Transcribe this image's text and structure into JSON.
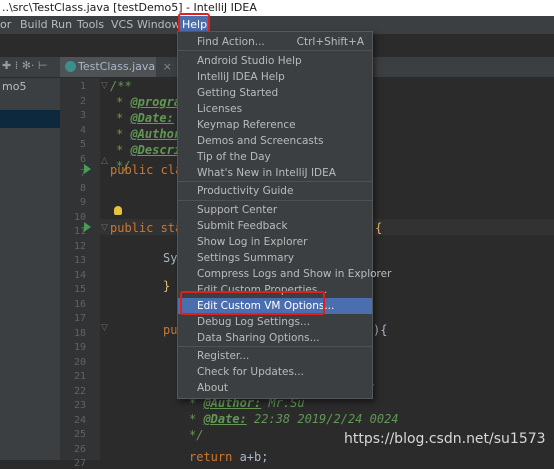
{
  "window": {
    "title": "..\\src\\TestClass.java [testDemo5] - IntelliJ IDEA"
  },
  "menubar": {
    "items": [
      "or",
      "Build",
      "Run",
      "Tools",
      "VCS",
      "Window",
      "Help"
    ]
  },
  "project": {
    "label": "mo5"
  },
  "editor": {
    "tab_label": "TestClass.java",
    "tab_close": "×",
    "line_numbers": [
      "1",
      "2",
      "3",
      "4",
      "5",
      "6",
      "7",
      "8",
      "9",
      "10",
      "11",
      "12",
      "13",
      "14",
      "15",
      "16",
      "17",
      "18",
      "19",
      "20",
      "21",
      "22",
      "23",
      "24",
      "25",
      "26",
      "27"
    ],
    "lines": {
      "l1": "/**",
      "l2": "@program",
      "l3": "@Date:",
      "l4": "@Author",
      "l5": "@Descri",
      "l6": "*/",
      "l7_kw": "public clas",
      "l11_kw": "public stat",
      "l11_end": "{",
      "l13": "Sys",
      "l15": "}",
      "l18": "pul",
      "l18_end": "){",
      "l22": "r",
      "l24_tag": "@Author:",
      "l24_val": " Mr.Su",
      "l25_tag": "@Date:",
      "l25_val": " 22:38 2019/2/24 0024",
      "l26": "*/",
      "l27_kw": "return",
      "l27_rest": " a+b;"
    }
  },
  "help_menu": {
    "items": [
      {
        "label": "Find Action...",
        "shortcut": "Ctrl+Shift+A"
      },
      {
        "label": "Android Studio Help"
      },
      {
        "label": "IntelliJ IDEA Help"
      },
      {
        "label": "Getting Started"
      },
      {
        "label": "Licenses"
      },
      {
        "label": "Keymap Reference"
      },
      {
        "label": "Demos and Screencasts"
      },
      {
        "label": "Tip of the Day"
      },
      {
        "label": "What's New in IntelliJ IDEA"
      },
      {
        "label": "Productivity Guide"
      },
      {
        "label": "Support Center"
      },
      {
        "label": "Submit Feedback"
      },
      {
        "label": "Show Log in Explorer"
      },
      {
        "label": "Settings Summary"
      },
      {
        "label": "Compress Logs and Show in Explorer"
      },
      {
        "label": "Edit Custom Properties..."
      },
      {
        "label": "Edit Custom VM Options...",
        "selected": true
      },
      {
        "label": "Debug Log Settings..."
      },
      {
        "label": "Data Sharing Options..."
      },
      {
        "label": "Register..."
      },
      {
        "label": "Check for Updates..."
      },
      {
        "label": "About"
      }
    ]
  },
  "watermark": "https://blog.csdn.net/su1573",
  "colors": {
    "menu_bg": "#3c3f41",
    "selection": "#4b6eaf",
    "highlight_box": "#e0201c",
    "editor_bg": "#2b2b2b"
  }
}
